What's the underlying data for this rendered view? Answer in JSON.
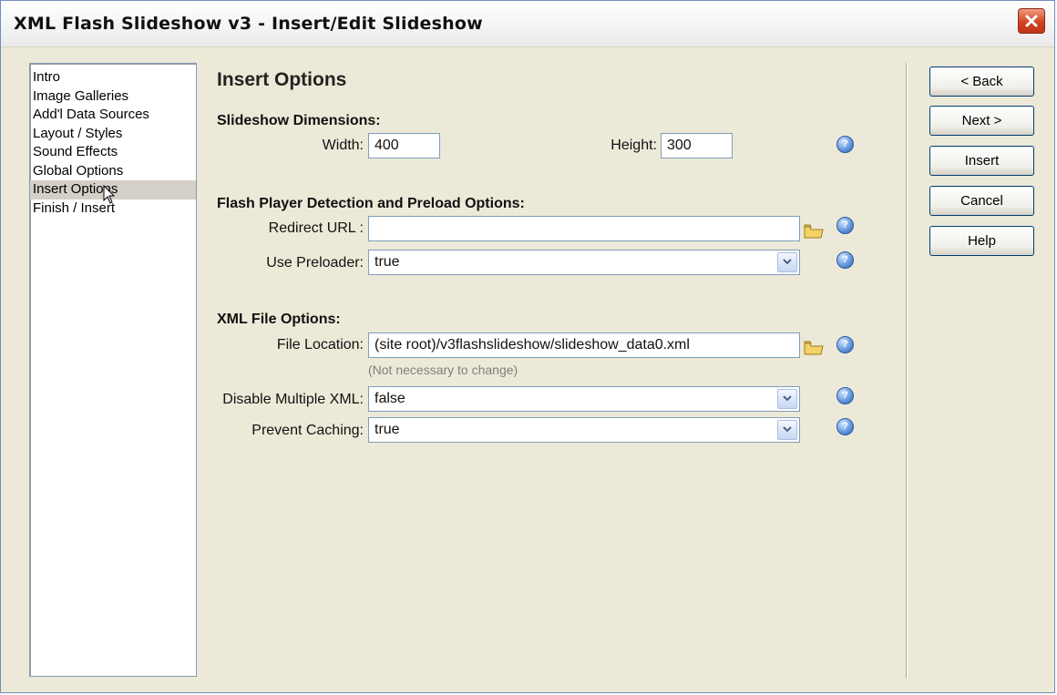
{
  "window": {
    "title": "XML Flash Slideshow v3 - Insert/Edit Slideshow"
  },
  "nav": {
    "items": [
      {
        "label": "Intro"
      },
      {
        "label": "Image Galleries"
      },
      {
        "label": "Add'l Data Sources"
      },
      {
        "label": "Layout / Styles"
      },
      {
        "label": "Sound Effects"
      },
      {
        "label": "Global Options"
      },
      {
        "label": "Insert Options",
        "selected": true
      },
      {
        "label": "Finish / Insert"
      }
    ]
  },
  "page": {
    "title": "Insert Options",
    "dimensions": {
      "heading": "Slideshow Dimensions:",
      "width_label": "Width:",
      "width_value": "400",
      "height_label": "Height:",
      "height_value": "300"
    },
    "flash": {
      "heading": "Flash Player Detection and Preload Options:",
      "redirect_label": "Redirect URL :",
      "redirect_value": "",
      "preloader_label": "Use Preloader:",
      "preloader_value": "true"
    },
    "xml": {
      "heading": "XML File Options:",
      "file_label": "File Location:",
      "file_value": "(site root)/v3flashslideshow/slideshow_data0.xml",
      "file_hint": "(Not necessary to change)",
      "disable_label": "Disable Multiple XML:",
      "disable_value": "false",
      "caching_label": "Prevent Caching:",
      "caching_value": "true"
    }
  },
  "buttons": {
    "back": "< Back",
    "next": "Next >",
    "insert": "Insert",
    "cancel": "Cancel",
    "help": "Help"
  },
  "colors": {
    "dialog_bg": "#ece9d8",
    "accent_border": "#7f9db9",
    "close_red": "#d2431f"
  }
}
